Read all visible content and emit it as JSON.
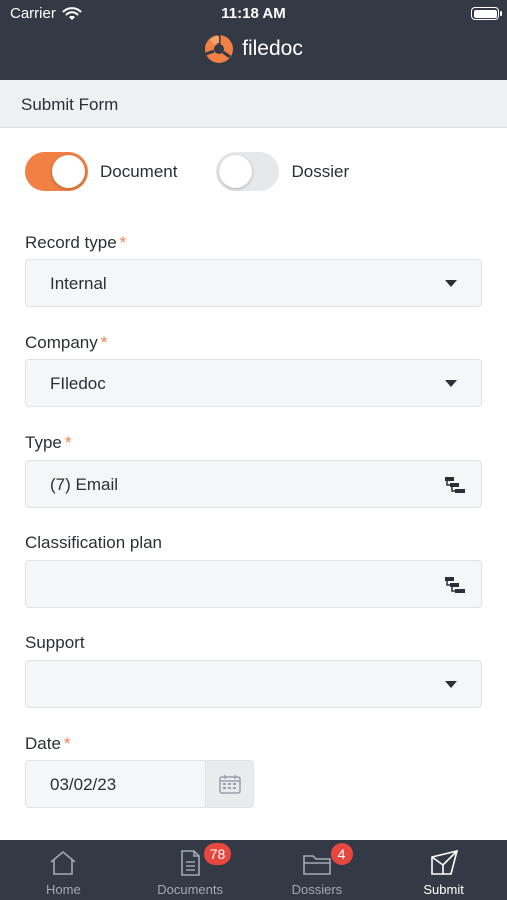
{
  "status_bar": {
    "carrier": "Carrier",
    "time": "11:18 AM"
  },
  "header": {
    "app_name": "filedoc"
  },
  "section": {
    "title": "Submit Form"
  },
  "toggles": [
    {
      "label": "Document",
      "on": true
    },
    {
      "label": "Dossier",
      "on": false
    }
  ],
  "fields": {
    "record_type": {
      "label": "Record type",
      "required_mark": "*",
      "value": "Internal"
    },
    "company": {
      "label": "Company",
      "required_mark": "*",
      "value": "FIledoc"
    },
    "type": {
      "label": "Type",
      "required_mark": "*",
      "value": "(7) Email"
    },
    "classification_plan": {
      "label": "Classification plan",
      "value": ""
    },
    "support": {
      "label": "Support",
      "value": ""
    },
    "date": {
      "label": "Date",
      "required_mark": "*",
      "value": "03/02/23"
    }
  },
  "tab_bar": {
    "tabs": [
      {
        "label": "Home",
        "icon": "home-icon"
      },
      {
        "label": "Documents",
        "icon": "document-icon",
        "badge": "78"
      },
      {
        "label": "Dossiers",
        "icon": "folder-icon",
        "badge": "4"
      },
      {
        "label": "Submit",
        "icon": "send-icon",
        "active": true
      }
    ]
  },
  "colors": {
    "header_bg": "#343a45",
    "accent": "#f08044",
    "badge": "#e8473f"
  }
}
